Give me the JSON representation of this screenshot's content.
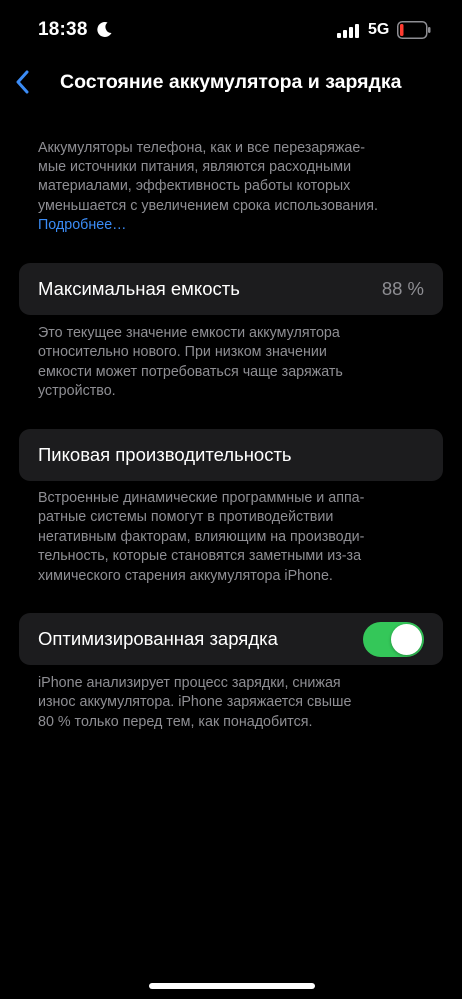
{
  "status_bar": {
    "time": "18:38",
    "network": "5G",
    "icons": [
      "moon-icon",
      "cellular-signal-icon",
      "battery-low-icon"
    ],
    "battery_color": "#ff3b30"
  },
  "nav": {
    "back_icon": "chevron-left-icon",
    "title": "Состояние аккумулятора и зарядка",
    "accent_color": "#3b8cf6"
  },
  "intro": {
    "text": "Аккумуляторы телефона, как и все перезаряжае-\nмые источники питания, являются расходными\nматериалами, эффективность работы которых\nуменьшается с увеличением срока использования.",
    "link": "Подробнее…"
  },
  "max_capacity": {
    "label": "Максимальная емкость",
    "value": "88 %",
    "footnote": "Это текущее значение емкости аккумулятора\nотносительно нового. При низком значении\nемкости может потребоваться чаще заряжать\nустройство."
  },
  "peak_performance": {
    "label": "Пиковая производительность",
    "footnote": "Встроенные динамические программные и аппа-\nратные системы помогут в противодействии\nнегативным факторам, влияющим на производи-\nтельность, которые становятся заметными из-за\nхимического старения аккумулятора iPhone."
  },
  "optimized_charging": {
    "label": "Оптимизированная зарядка",
    "enabled": true,
    "toggle_color": "#34c759",
    "footnote": "iPhone анализирует процесс зарядки, снижая\nизнос аккумулятора. iPhone заряжается свыше\n80 % только перед тем, как понадобится."
  }
}
